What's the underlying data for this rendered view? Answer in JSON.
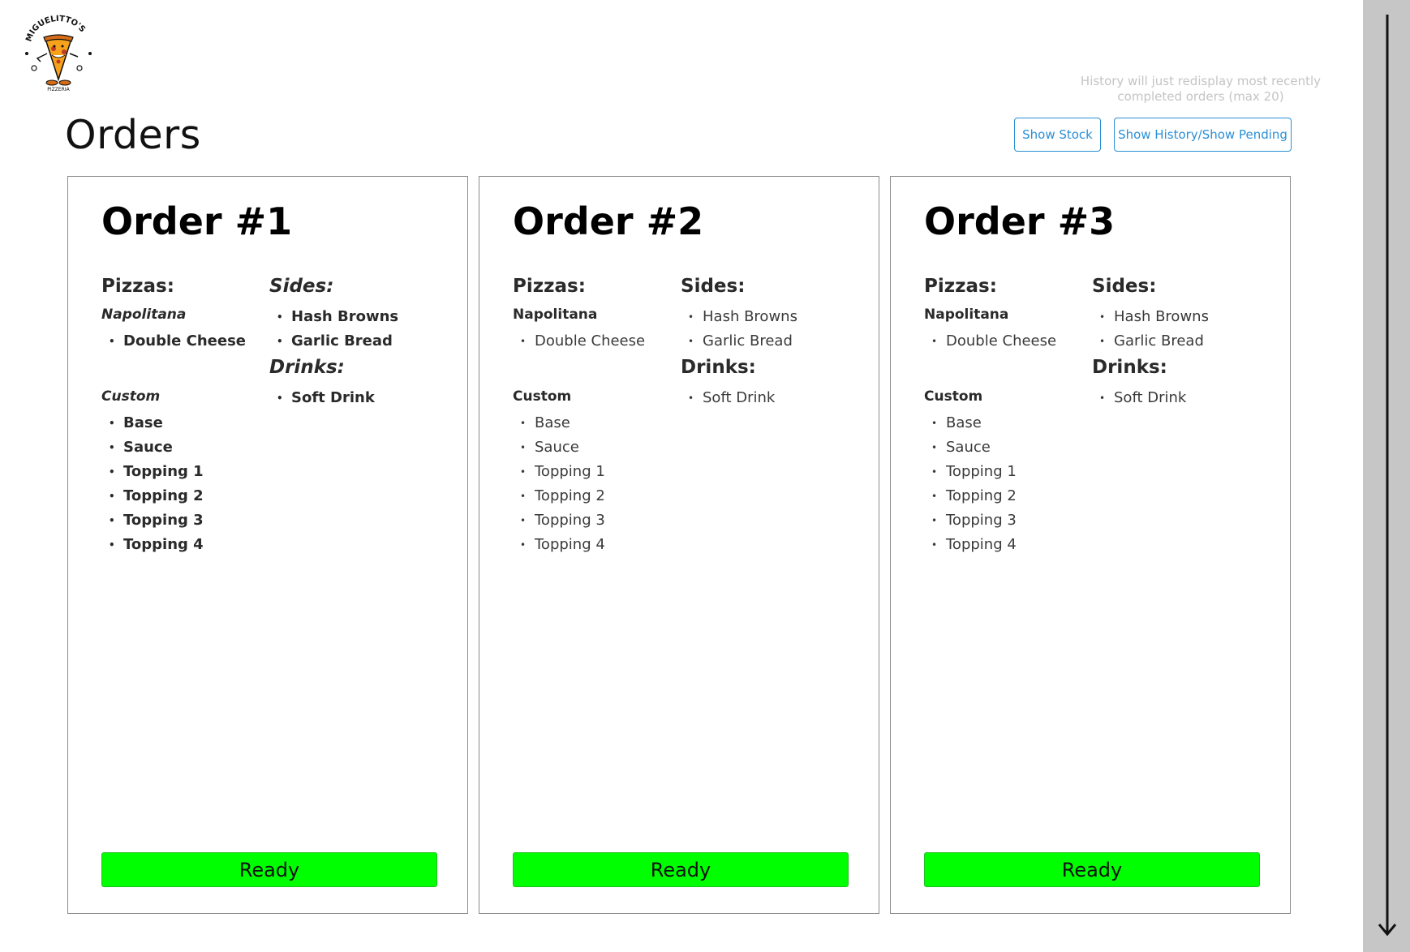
{
  "logo": {
    "brand_text": "MIGUELITTO'S",
    "sub_text": "PIZZERIA"
  },
  "page": {
    "title": "Orders"
  },
  "history_note": "History will  just redisplay most recently completed orders (max 20)",
  "buttons": {
    "show_stock": "Show Stock",
    "show_history": "Show History/Show Pending"
  },
  "orders": [
    {
      "title": "Order #1",
      "pizzas_label": "Pizzas:",
      "pizza_name": "Napolitana",
      "pizza_items": [
        "Double Cheese"
      ],
      "custom_label": "Custom",
      "custom_items": [
        "Base",
        "Sauce",
        "Topping 1",
        "Topping 2",
        "Topping 3",
        "Topping 4"
      ],
      "sides_label": "Sides:",
      "side_items": [
        "Hash Browns",
        "Garlic Bread"
      ],
      "drinks_label": "Drinks:",
      "drink_items": [
        "Soft Drink"
      ],
      "ready_label": "Ready"
    },
    {
      "title": "Order #2",
      "pizzas_label": "Pizzas:",
      "pizza_name": "Napolitana",
      "pizza_items": [
        "Double Cheese"
      ],
      "custom_label": "Custom",
      "custom_items": [
        "Base",
        "Sauce",
        "Topping 1",
        "Topping 2",
        "Topping 3",
        "Topping 4"
      ],
      "sides_label": "Sides:",
      "side_items": [
        "Hash Browns",
        "Garlic Bread"
      ],
      "drinks_label": "Drinks:",
      "drink_items": [
        "Soft Drink"
      ],
      "ready_label": "Ready"
    },
    {
      "title": "Order #3",
      "pizzas_label": "Pizzas:",
      "pizza_name": "Napolitana",
      "pizza_items": [
        "Double Cheese"
      ],
      "custom_label": "Custom",
      "custom_items": [
        "Base",
        "Sauce",
        "Topping 1",
        "Topping 2",
        "Topping 3",
        "Topping 4"
      ],
      "sides_label": "Sides:",
      "side_items": [
        "Hash Browns",
        "Garlic Bread"
      ],
      "drinks_label": "Drinks:",
      "drink_items": [
        "Soft Drink"
      ],
      "ready_label": "Ready"
    }
  ],
  "colors": {
    "ready_green": "#00ff00",
    "link_blue": "#2a8fd6",
    "scrollbar_gray": "#c6c6c6"
  },
  "icons": {
    "scroll": "down-arrow-icon",
    "logo": "pizza-mascot-logo"
  }
}
